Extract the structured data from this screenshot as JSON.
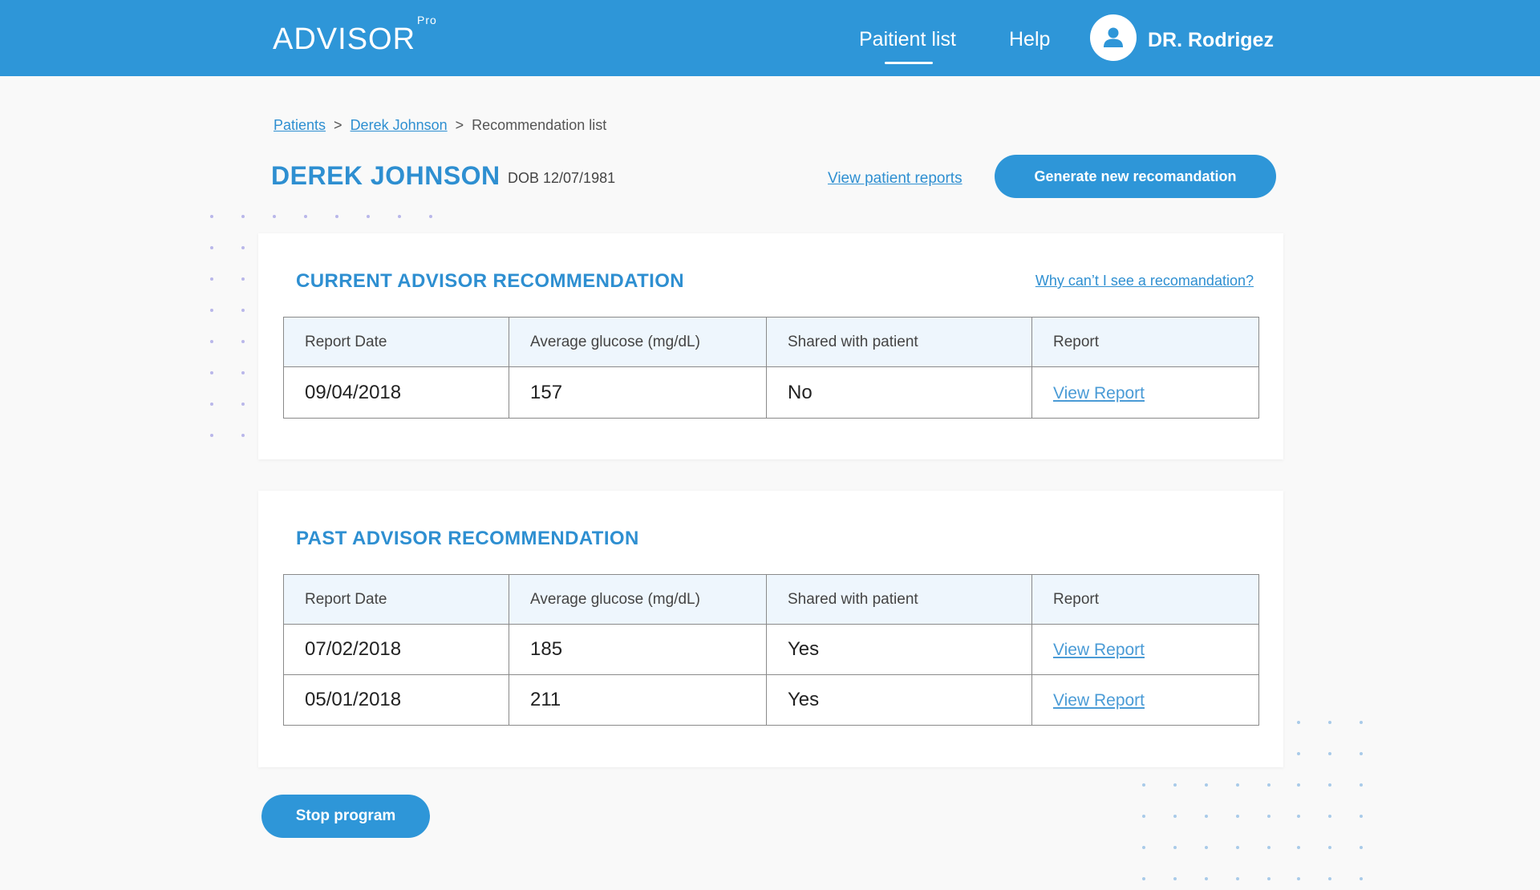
{
  "header": {
    "logo": "ADVISOR",
    "logo_sup": "Pro",
    "nav": {
      "patient_list": "Paitient list",
      "help": "Help"
    },
    "user_name": "DR. Rodrigez"
  },
  "breadcrumb": {
    "items": [
      "Patients",
      "Derek Johnson",
      "Recommendation list"
    ],
    "separator": ">"
  },
  "patient": {
    "name": "DEREK JOHNSON",
    "dob": "DOB 12/07/1981",
    "view_reports_label": "View patient reports",
    "generate_label": "Generate new recomandation"
  },
  "current": {
    "title": "CURRENT ADVISOR RECOMMENDATION",
    "help_link": "Why can’t I see a recomandation?",
    "columns": [
      "Report Date",
      "Average glucose (mg/dL)",
      "Shared with patient",
      "Report"
    ],
    "rows": [
      {
        "date": "09/04/2018",
        "glucose": "157",
        "shared": "No",
        "report": "View Report"
      }
    ]
  },
  "past": {
    "title": "PAST ADVISOR RECOMMENDATION",
    "columns": [
      "Report Date",
      "Average glucose (mg/dL)",
      "Shared with patient",
      "Report"
    ],
    "rows": [
      {
        "date": "07/02/2018",
        "glucose": "185",
        "shared": "Yes",
        "report": "View Report"
      },
      {
        "date": "05/01/2018",
        "glucose": "211",
        "shared": "Yes",
        "report": "View Report"
      }
    ]
  },
  "actions": {
    "stop_label": "Stop program"
  },
  "colors": {
    "primary": "#2e96d8",
    "link": "#2e8fd1",
    "header_cell_bg": "#eef6fd",
    "page_bg": "#f9f9f9",
    "dot_left": "#b9b7ea",
    "dot_right": "#a9cbe9"
  }
}
